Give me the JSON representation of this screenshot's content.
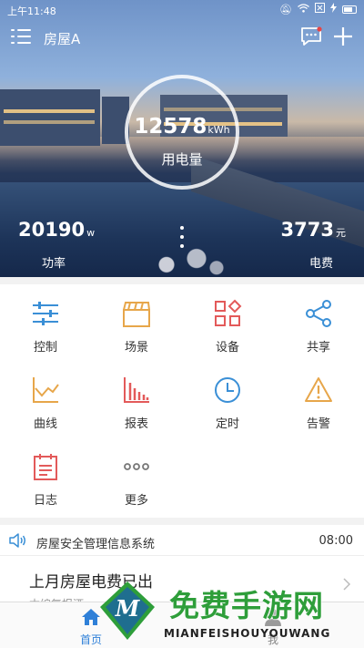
{
  "status_bar": {
    "time": "上午11:48",
    "icons": [
      "mute-icon",
      "wifi-icon",
      "sim-off-icon",
      "charging-icon",
      "battery-icon"
    ]
  },
  "header": {
    "house_name": "房屋A",
    "icons": [
      "menu-icon",
      "chat-icon",
      "plus-icon"
    ]
  },
  "energy": {
    "value": "12578",
    "unit": "kWh",
    "label": "用电量"
  },
  "power": {
    "value": "20190",
    "unit": "w",
    "label": "功率"
  },
  "cost": {
    "value": "3773",
    "unit": "元",
    "label": "电费"
  },
  "grid": {
    "items": [
      {
        "label": "控制",
        "icon": "sliders-icon",
        "color": "#3a8fd6"
      },
      {
        "label": "场景",
        "icon": "clapperboard-icon",
        "color": "#e7a64a"
      },
      {
        "label": "设备",
        "icon": "devices-icon",
        "color": "#e35a5a"
      },
      {
        "label": "共享",
        "icon": "share-icon",
        "color": "#3a8fd6"
      },
      {
        "label": "曲线",
        "icon": "line-chart-icon",
        "color": "#e7a64a"
      },
      {
        "label": "报表",
        "icon": "bar-chart-icon",
        "color": "#e35a5a"
      },
      {
        "label": "定时",
        "icon": "clock-icon",
        "color": "#3a8fd6"
      },
      {
        "label": "告警",
        "icon": "warning-icon",
        "color": "#e7a64a"
      },
      {
        "label": "日志",
        "icon": "log-icon",
        "color": "#e35a5a"
      },
      {
        "label": "更多",
        "icon": "more-icon",
        "color": "#777777"
      }
    ]
  },
  "notice": {
    "text": "房屋安全管理信息系统",
    "time": "08:00"
  },
  "message": {
    "title": "上月房屋电费已出",
    "subtitle": "本编复报酒"
  },
  "bottom_nav": {
    "items": [
      {
        "label": "首页",
        "icon": "home-icon",
        "active": true
      },
      {
        "label": "我",
        "icon": "user-icon",
        "active": false
      }
    ],
    "active_color": "#2f80d8"
  },
  "watermark": {
    "text": "免费手游网",
    "sub": "MIANFEISHOUYOUWANG",
    "letter": "M"
  }
}
